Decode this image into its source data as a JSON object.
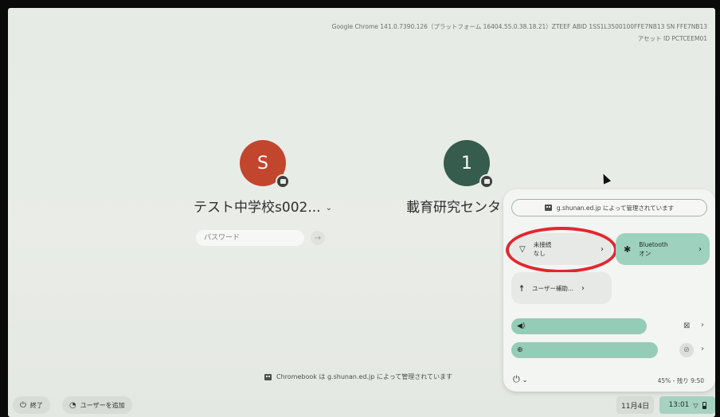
{
  "version_info": {
    "line1": "Google Chrome 141.0.7390.126（プラットフォーム 16404.55.0.38.18.21）ZTEEF ABID 1SS1L3500100FFE7NB13 SN FFE7NB13",
    "line2": "アセット ID PCTCEEM01"
  },
  "pods": [
    {
      "initial": "S",
      "color": "#c2462d",
      "name": "テスト中学校s002...",
      "chevron": "⌄"
    },
    {
      "initial": "1",
      "color": "#355c4c",
      "name": "載育研究センタ"
    }
  ],
  "password": {
    "placeholder": "パスワード",
    "submit_glyph": "→"
  },
  "managed_bottom": "Chromebook は g.shunan.ed.jp によって管理されています",
  "shelf": {
    "shutdown_icon": "power-icon",
    "shutdown_label": "終了",
    "add_user_icon": "add-user-icon",
    "add_user_label": "ユーザーを追加",
    "date": "11月4日",
    "time": "13:01"
  },
  "quick_settings": {
    "managed_text": "g.shunan.ed.jp によって管理されています",
    "network": {
      "title": "未接続",
      "subtitle": "なし",
      "icon": "wifi-icon"
    },
    "bluetooth": {
      "title": "Bluetooth",
      "subtitle": "オン",
      "icon": "bluetooth-icon"
    },
    "accessibility": {
      "title": "ユーザー補助...",
      "icon": "accessibility-icon"
    },
    "volume_icon": "speaker-icon",
    "brightness_icon": "brightness-icon",
    "battery_text": "45% - 残り 9:50",
    "accent_color": "#94ccb8"
  }
}
